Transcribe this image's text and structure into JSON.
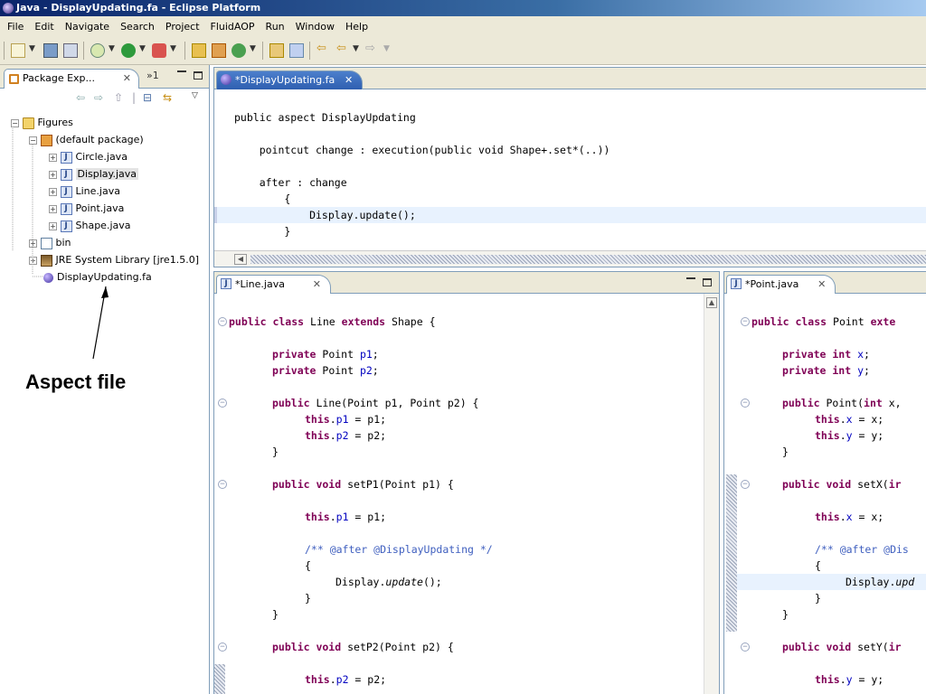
{
  "window": {
    "title": "Java - DisplayUpdating.fa - Eclipse Platform"
  },
  "menu": [
    "File",
    "Edit",
    "Navigate",
    "Search",
    "Project",
    "FluidAOP",
    "Run",
    "Window",
    "Help"
  ],
  "package_explorer": {
    "tab_label": "Package Exp...",
    "overflow_label": "»1",
    "tree": {
      "project": "Figures",
      "package": "(default package)",
      "files": [
        "Circle.java",
        "Display.java",
        "Line.java",
        "Point.java",
        "Shape.java"
      ],
      "bin": "bin",
      "jre": "JRE System Library [jre1.5.0]",
      "aspect_file": "DisplayUpdating.fa"
    }
  },
  "annotation": {
    "label": "Aspect file"
  },
  "aspect_editor": {
    "tab_label": "*DisplayUpdating.fa",
    "lines": [
      "public aspect DisplayUpdating",
      "    pointcut change : execution(public void Shape+.set*(..))",
      "    after : change",
      "        {",
      "            Display.update();",
      "        }"
    ]
  },
  "line_editor": {
    "tab_label": "*Line.java",
    "lines": [
      {
        "k": "public class",
        "t": " Line ",
        "k2": "extends",
        "t2": " Shape {"
      },
      {
        "k": "private",
        "t": " Point ",
        "f": "p1",
        "t2": ";"
      },
      {
        "k": "private",
        "t": " Point ",
        "f": "p2",
        "t2": ";"
      },
      {
        "k": "public",
        "t": " Line(Point p1, Point p2) {"
      },
      {
        "k": "this",
        "t": ".",
        "f": "p1",
        "t2": " = p1;"
      },
      {
        "k": "this",
        "t": ".",
        "f": "p2",
        "t2": " = p2;"
      },
      {
        "t": "}"
      },
      {
        "k": "public void",
        "t": " setP1(Point p1) {"
      },
      {
        "k": "this",
        "t": ".",
        "f": "p1",
        "t2": " = p1;"
      },
      {
        "c": "/** @after @DisplayUpdating */"
      },
      {
        "t": "{"
      },
      {
        "t": "Display.",
        "i": "update",
        "t2": "();"
      },
      {
        "t": "}"
      },
      {
        "t": "}"
      },
      {
        "k": "public void",
        "t": " setP2(Point p2) {"
      },
      {
        "k": "this",
        "t": ".",
        "f": "p2",
        "t2": " = p2;"
      }
    ]
  },
  "point_editor": {
    "tab_label": "*Point.java",
    "lines": [
      {
        "k": "public class",
        "t": " Point ",
        "k2": "exte"
      },
      {
        "k": "private int",
        "t": " ",
        "f": "x",
        "t2": ";"
      },
      {
        "k": "private int",
        "t": " ",
        "f": "y",
        "t2": ";"
      },
      {
        "k": "public",
        "t": " Point(",
        "k2": "int",
        "t2": " x,"
      },
      {
        "k": "this",
        "t": ".",
        "f": "x",
        "t2": " = x;"
      },
      {
        "k": "this",
        "t": ".",
        "f": "y",
        "t2": " = y;"
      },
      {
        "t": "}"
      },
      {
        "k": "public void",
        "t": " setX(",
        "k2": "ir"
      },
      {
        "k": "this",
        "t": ".",
        "f": "x",
        "t2": " = x;"
      },
      {
        "c": "/** @after @Dis"
      },
      {
        "t": "{"
      },
      {
        "t": "Display.",
        "i": "upd"
      },
      {
        "t": "}"
      },
      {
        "t": "}"
      },
      {
        "k": "public void",
        "t": " setY(",
        "k2": "ir"
      },
      {
        "k": "this",
        "t": ".",
        "f": "y",
        "t2": " = y;"
      }
    ]
  },
  "colors": {
    "keyword": "#7f0055",
    "field": "#0000c0",
    "comment": "#3f5fbf",
    "active_tab": "#2f5fb0",
    "highlight": "#e8f2fe"
  }
}
